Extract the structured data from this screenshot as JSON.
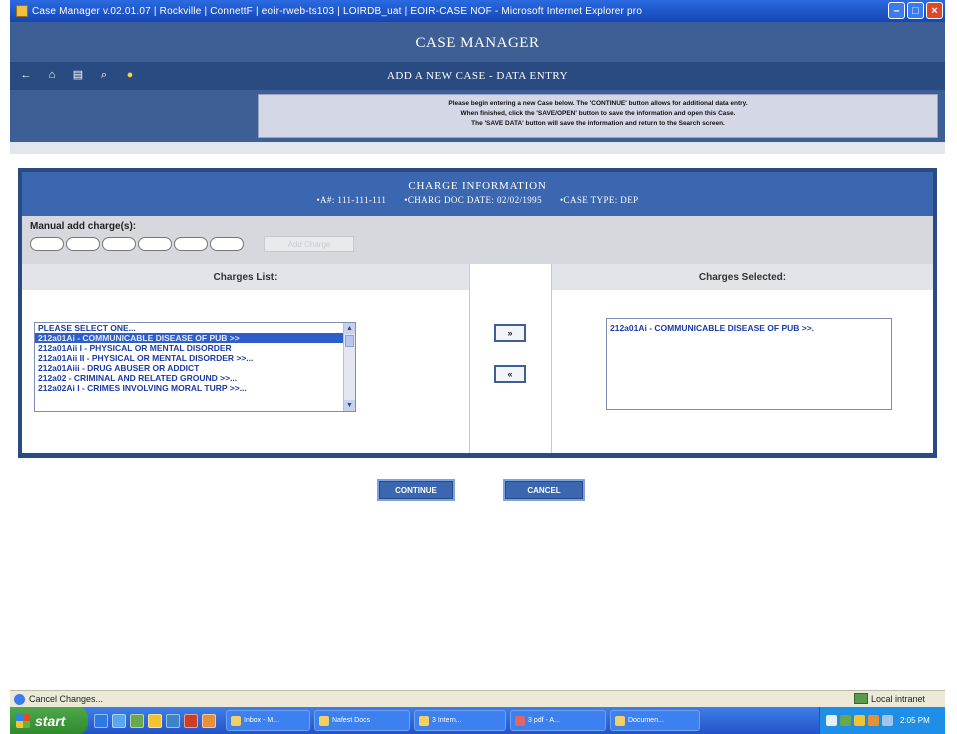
{
  "window": {
    "title": "Case Manager v.02.01.07 | Rockville | ConnettF | eoir-rweb-ts103 | LOIRDB_uat | EOIR-CASE NOF - Microsoft Internet Explorer pro",
    "minimize": "–",
    "maximize": "□",
    "close": "×"
  },
  "header": {
    "app_title": "CASE MANAGER",
    "page_title": "ADD A NEW CASE - DATA ENTRY"
  },
  "toolbar": {
    "icons": [
      "back-arrow-icon",
      "home-icon",
      "print-icon",
      "search-icon",
      "help-icon"
    ],
    "glyphs": [
      "←",
      "⌂",
      "▤",
      "⌕",
      "●"
    ]
  },
  "instructions": {
    "line1": "Please begin entering a new Case below. The 'CONTINUE' button allows for additional data entry.",
    "line2": "When finished, click the 'SAVE/OPEN' button to save the information and open this Case.",
    "line3": "The 'SAVE DATA' button will save the information and return to the Search screen."
  },
  "charge_info": {
    "title": "CHARGE INFORMATION",
    "a_number": "•A#: 111-111-111",
    "charg_doc_date": "•CHARG DOC DATE: 02/02/1995",
    "case_type": "•CASE TYPE: DEP"
  },
  "manual_add": {
    "label": "Manual add charge(s):",
    "add_button": "Add Charge"
  },
  "charges_list": {
    "header": "Charges List:",
    "options": [
      {
        "text": "PLEASE SELECT ONE...",
        "selected": false
      },
      {
        "text": "212a01Ai - COMMUNICABLE DISEASE OF PUB >>",
        "selected": true
      },
      {
        "text": "212a01Aii I - PHYSICAL OR MENTAL DISORDER",
        "selected": false
      },
      {
        "text": "212a01Aii II - PHYSICAL OR MENTAL DISORDER >>...",
        "selected": false
      },
      {
        "text": "212a01Aiii - DRUG ABUSER OR ADDICT",
        "selected": false
      },
      {
        "text": "212a02 - CRIMINAL AND RELATED GROUND >>...",
        "selected": false
      },
      {
        "text": "212a02Ai I - CRIMES INVOLVING MORAL TURP >>...",
        "selected": false
      }
    ]
  },
  "move_buttons": {
    "add": "»",
    "remove": "«"
  },
  "charges_selected": {
    "header": "Charges Selected:",
    "items": [
      "212a01Ai - COMMUNICABLE DISEASE OF PUB >>."
    ]
  },
  "actions": {
    "continue": "CONTINUE",
    "cancel": "CANCEL"
  },
  "statusbar": {
    "text": "Cancel Changes...",
    "zone": "Local intranet"
  },
  "taskbar": {
    "start": "start",
    "tasks": [
      "Inbox - M...",
      "Nafest Docs",
      "3 Intern...",
      "3 pdf - A...",
      "Documen..."
    ],
    "clock": "2:05 PM"
  },
  "colors": {
    "header_blue": "#3d5f95",
    "panel_dark_blue": "#2a4b82",
    "list_text_blue": "#1a3aa8",
    "selection_blue": "#2d5ec9"
  }
}
